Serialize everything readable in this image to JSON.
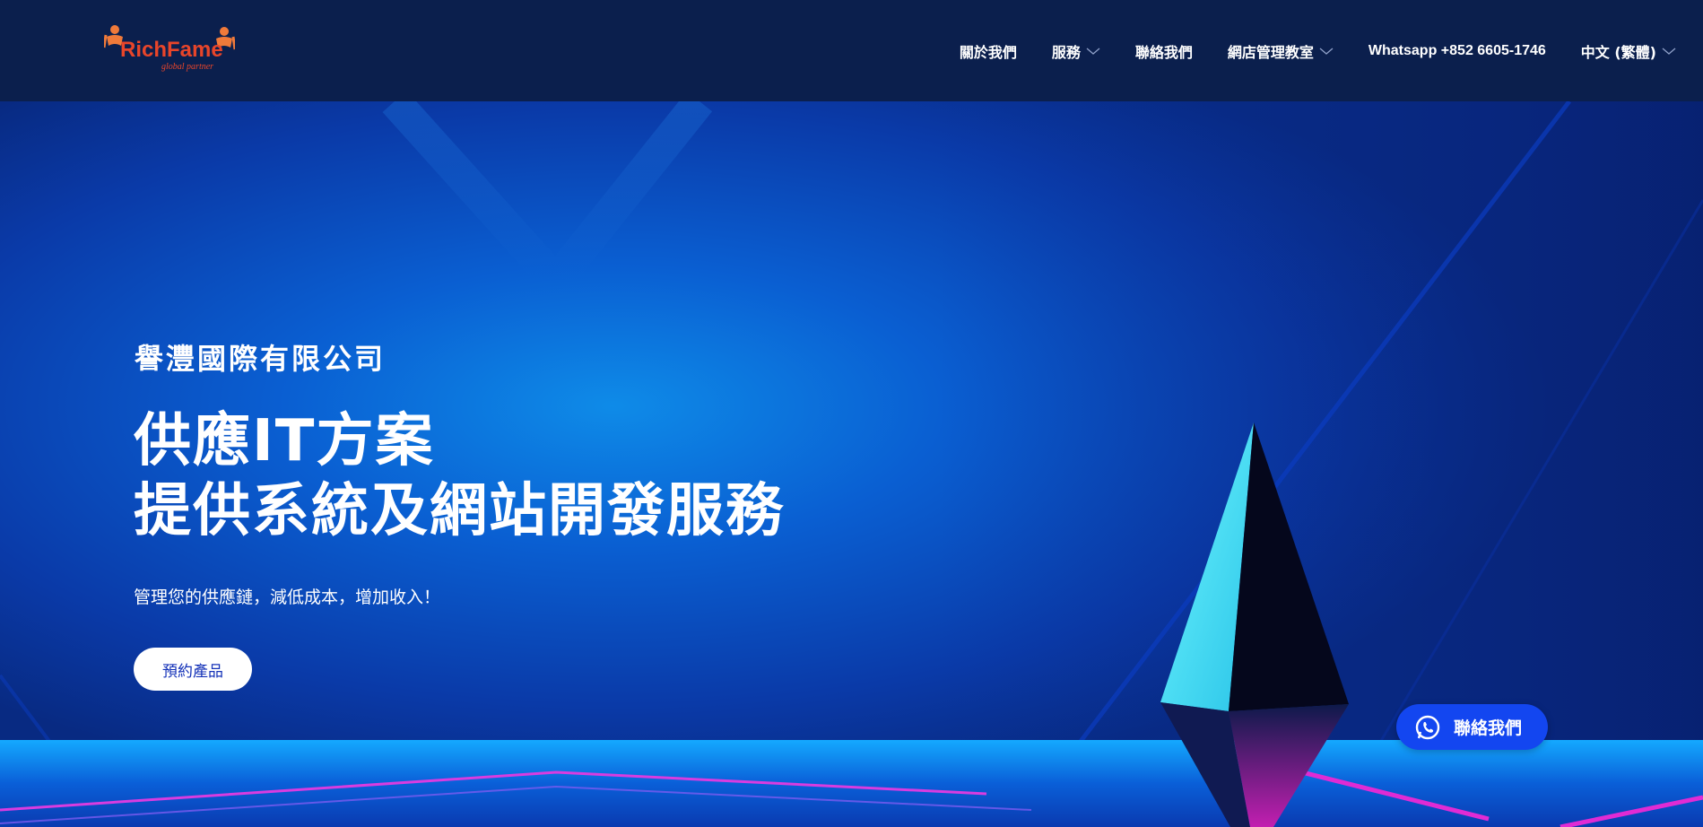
{
  "brand": {
    "name": "RichFame",
    "tagline": "global partner",
    "name_color": "#e8452a",
    "figure_color": "#f07a3a"
  },
  "nav": {
    "items": [
      {
        "label": "關於我們",
        "dropdown": false
      },
      {
        "label": "服務",
        "dropdown": true
      },
      {
        "label": "聯絡我們",
        "dropdown": false
      },
      {
        "label": "網店管理教室",
        "dropdown": true
      },
      {
        "label": "Whatsapp +852 6605-1746",
        "dropdown": false
      },
      {
        "label": "中文 (繁體)",
        "dropdown": true
      }
    ]
  },
  "hero": {
    "company": "譽灃國際有限公司",
    "headline_line1": "供應IT方案",
    "headline_line2": "提供系統及網站開發服務",
    "tagline": "管理您的供應鏈，減低成本，增加收入！",
    "cta_label": "預約產品"
  },
  "floating_contact": {
    "label": "聯絡我們",
    "icon": "whatsapp-icon"
  },
  "colors": {
    "header_bg": "#0b1f4d",
    "hero_blue": "#0a4fc8",
    "cta_text": "#1432b8",
    "float_button": "#1346f0",
    "accent_magenta": "#e02bd4",
    "accent_cyan": "#5ef0ff"
  }
}
